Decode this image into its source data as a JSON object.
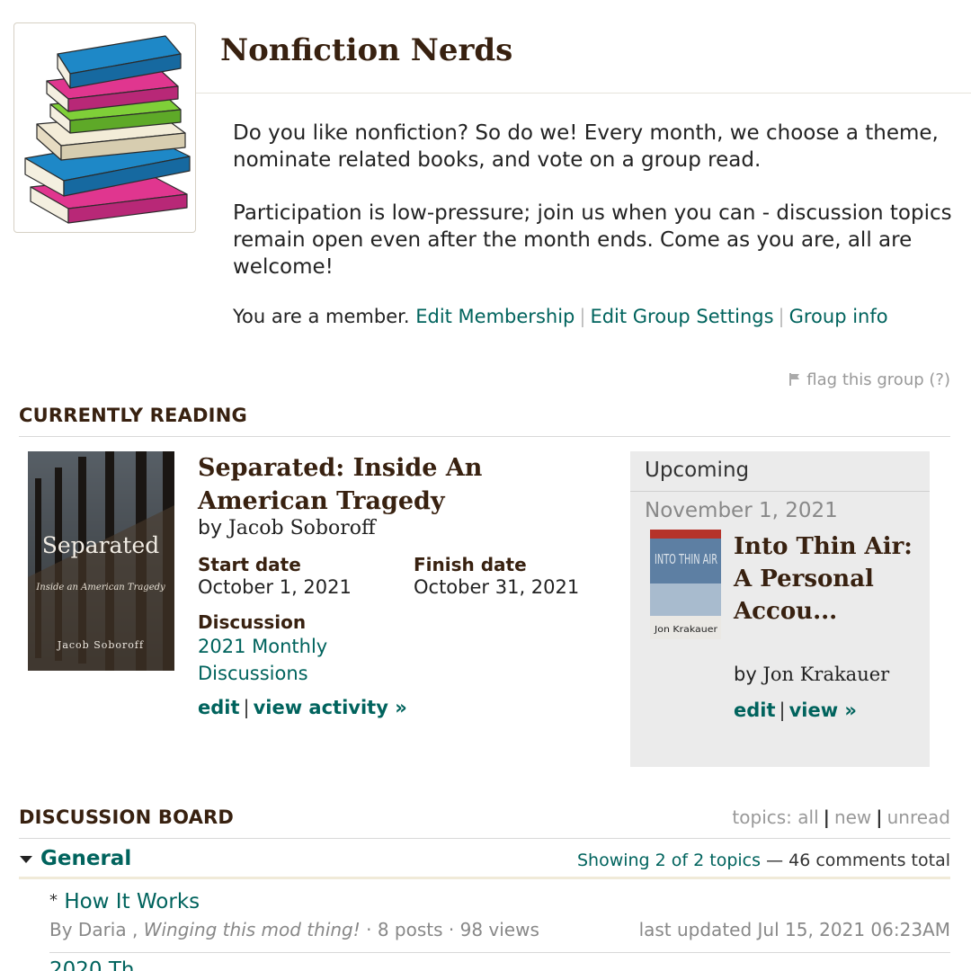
{
  "group": {
    "title": "Nonfiction Nerds",
    "description": [
      "Do you like nonfiction? So do we! Every month, we choose a theme, nominate related books, and vote on a group read.",
      "Participation is low-pressure; join us when you can - discussion topics remain open even after the month ends. Come as you are, all are welcome!"
    ],
    "member_status": "You are a member.",
    "links": [
      "Edit Membership",
      "Edit Group Settings",
      "Group info"
    ],
    "flag": "flag this group",
    "flag_help": "(?)"
  },
  "currently_reading": {
    "heading": "CURRENTLY READING",
    "cover": {
      "title": "Separated",
      "subtitle": "Inside an American Tragedy",
      "author": "Jacob Soboroff"
    },
    "title": "Separated: Inside An American Tragedy",
    "by": "by",
    "author": "Jacob Soboroff",
    "start_label": "Start date",
    "start_value": "October 1, 2021",
    "finish_label": "Finish date",
    "finish_value": "October 31, 2021",
    "discussion_label": "Discussion",
    "discussion_link": "2021 Monthly Discussions",
    "edit": "edit",
    "view_activity": "view activity »"
  },
  "upcoming": {
    "heading": "Upcoming",
    "date": "November 1, 2021",
    "cover": {
      "title": "INTO THIN AIR",
      "author": "Jon Krakauer"
    },
    "title": "Into Thin Air: A Personal Accou...",
    "by": "by",
    "author": "Jon Krakauer",
    "edit": "edit",
    "view": "view »"
  },
  "discussion": {
    "heading": "DISCUSSION BOARD",
    "filter_prefix": "topics:",
    "filters": [
      "all",
      "new",
      "unread"
    ],
    "folder": "General",
    "showing": "Showing 2 of 2 topics",
    "comments_total": "— 46 comments total",
    "topics": [
      {
        "star": "*",
        "title": "How It Works",
        "by": "By Daria ,",
        "tagline": "Winging this mod thing!",
        "stats": "· 8 posts · 98 views",
        "updated": "last updated Jul 15, 2021 06:23AM"
      },
      {
        "title": "2020 Th"
      }
    ]
  },
  "colors": {
    "brand_brown": "#382110",
    "link_teal": "#00635d",
    "panel_grey": "#ebebeb"
  }
}
